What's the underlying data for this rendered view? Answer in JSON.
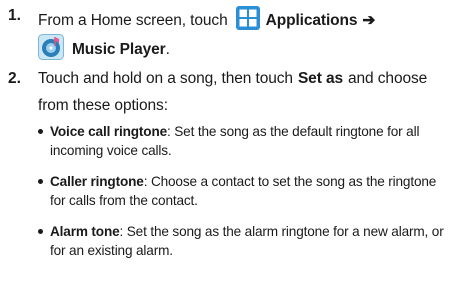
{
  "step1": {
    "number": "1.",
    "text_before": "From a Home screen, touch",
    "apps_label": "Applications",
    "arrow": "➔",
    "music_label": "Music Player",
    "music_suffix": ".",
    "apps_icon": "apps-grid-icon",
    "music_icon": "music-player-icon"
  },
  "step2": {
    "number": "2.",
    "text_a": "Touch and hold on a song, then touch",
    "set_as": "Set as",
    "text_b": "and choose",
    "text_c": "from these options:"
  },
  "options": [
    {
      "label": "Voice call ringtone",
      "desc_1": ": Set the song as the default ringtone for all",
      "desc_2": "incoming voice calls."
    },
    {
      "label": "Caller ringtone",
      "desc_1": ": Choose a contact to set the song as the ringtone",
      "desc_2": "for calls from the contact."
    },
    {
      "label": "Alarm tone",
      "desc_1": ": Set the song as the alarm ringtone for a new alarm, or",
      "desc_2": "for an existing alarm."
    }
  ],
  "colors": {
    "apps_icon": "#2a8fd6",
    "music_icon": "#c9e7f5"
  }
}
